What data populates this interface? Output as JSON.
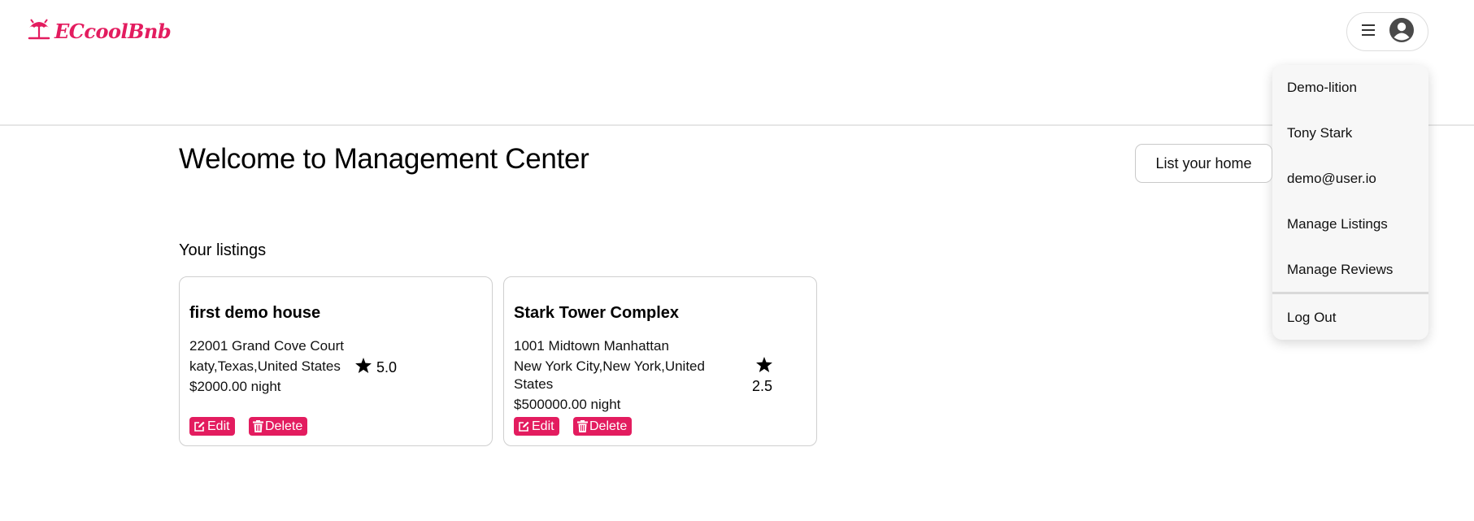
{
  "header": {
    "logo_text": "ECcoolBnb"
  },
  "user_menu": {
    "items": [
      {
        "label": "Demo-lition"
      },
      {
        "label": "Tony Stark"
      },
      {
        "label": "demo@user.io"
      },
      {
        "label": "Manage Listings"
      },
      {
        "label": "Manage Reviews"
      }
    ],
    "logout_label": "Log Out"
  },
  "main": {
    "title": "Welcome to Management Center",
    "list_home_label": "List your home",
    "section_title": "Your listings"
  },
  "listings": [
    {
      "name": "first demo house",
      "address": "22001 Grand Cove Court",
      "location": "katy,Texas,United States",
      "rating": "5.0",
      "price": "$2000.00 night",
      "edit_label": "Edit",
      "delete_label": "Delete"
    },
    {
      "name": "Stark Tower Complex",
      "address": "1001 Midtown Manhattan",
      "location_line1": "New York City,New York,United",
      "location_line2": "States",
      "rating": "2.5",
      "price": "$500000.00 night",
      "edit_label": "Edit",
      "delete_label": "Delete"
    }
  ],
  "colors": {
    "brand": "#e31c5f"
  },
  "icons": [
    "umbrella-logo-icon",
    "hamburger-menu-icon",
    "user-avatar-icon",
    "star-icon",
    "edit-icon",
    "trash-icon"
  ]
}
